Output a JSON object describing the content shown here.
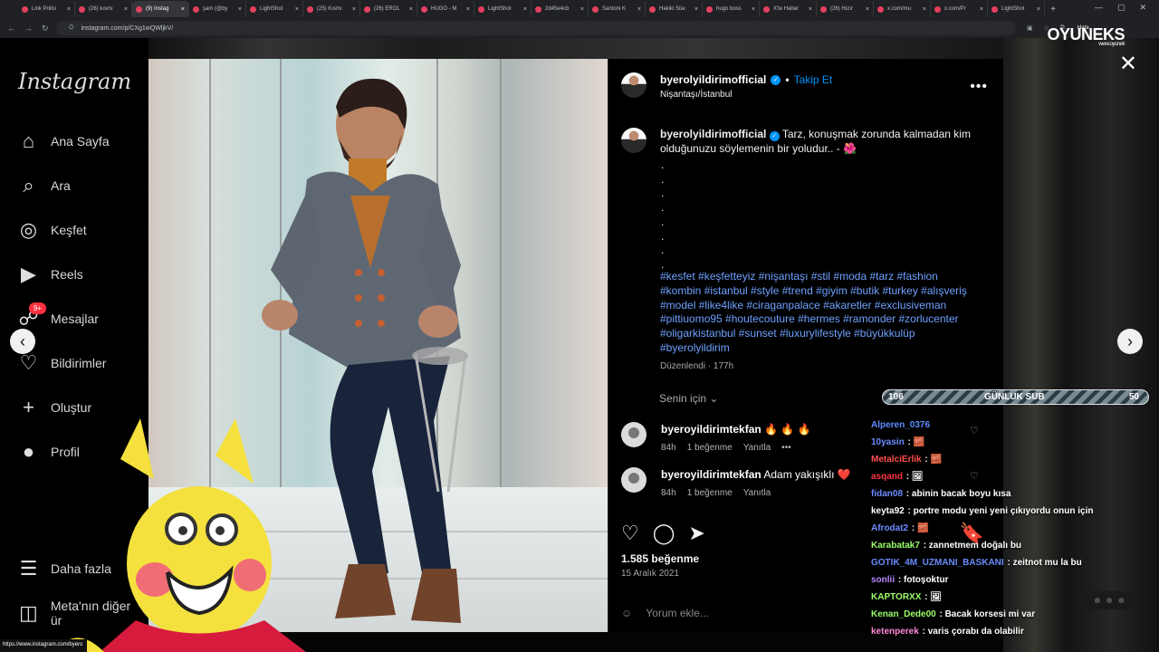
{
  "browser": {
    "tabs": [
      "Link Polisi",
      "(26) kısmı",
      "(9) Instag",
      "şam (@by",
      "LightShot",
      "(25) Kısmı",
      "(26) EROL",
      "HUGO - M",
      "LightShot",
      "2d45e4cb",
      "Santoni K",
      "Hakiki Süe",
      "hugo boss",
      "X'te Haber",
      "(26) Hızır",
      "x.com/mu",
      "x.com/Pr",
      "LightShot"
    ],
    "url": "instagram.com/p/CXg1wQWljkV/",
    "profile_label": "Hata",
    "status_url": "https://www.instagram.com/byero"
  },
  "instagram": {
    "logo": "Instagram",
    "sidebar": [
      {
        "label": "Ana Sayfa",
        "icon": "home-icon"
      },
      {
        "label": "Ara",
        "icon": "search-icon"
      },
      {
        "label": "Keşfet",
        "icon": "compass-icon"
      },
      {
        "label": "Reels",
        "icon": "reels-icon"
      },
      {
        "label": "Mesajlar",
        "icon": "messages-icon",
        "badge": "9+"
      },
      {
        "label": "Bildirimler",
        "icon": "heart-icon"
      },
      {
        "label": "Oluştur",
        "icon": "plus-icon"
      },
      {
        "label": "Profil",
        "icon": "profile-icon"
      },
      {
        "label": "Daha fazla",
        "icon": "menu-icon"
      },
      {
        "label": "Meta'nın diğer ür",
        "icon": "apps-icon"
      }
    ],
    "post": {
      "username": "byerolyildirimofficial",
      "follow": "Takip Et",
      "location": "Nişantaşı/İstanbul",
      "caption": "Tarz, konuşmak zorunda kalmadan kim olduğunuzu söylemenin bir yoludur.. - 🌺",
      "dots": [
        ".",
        ".",
        ".",
        ".",
        ".",
        ".",
        ".",
        "."
      ],
      "hashtags": "#kesfet #keşfetteyiz #nişantaşı #stil #moda #tarz #fashion #kombin #istanbul #style #trend #giyim #butik #turkey #alışveriş #model #like4like #ciraganpalace #akaretler #exclusiveman #pittiuomo95 #houtecouture #hermes #ramonder #zorlucenter #oligarkistanbul #sunset #luxurylifestyle #büyükkulüp #byerolyildirim",
      "edited": "Düzenlendi · 177h",
      "for_you": "Senin için",
      "comments": [
        {
          "user": "byeroyildirimtekfan",
          "text": "🔥 🔥 🔥",
          "time": "84h",
          "likes": "1 beğenme",
          "reply": "Yanıtla"
        },
        {
          "user": "byeroyildirimtekfan",
          "text": "Adam yakışıklı ❤️",
          "time": "84h",
          "likes": "1 beğenme",
          "reply": "Yanıtla"
        }
      ],
      "likes": "1.585 beğenme",
      "date": "15 Aralık 2021",
      "comment_placeholder": "Yorum ekle..."
    }
  },
  "overlay": {
    "brand": "OYUNEKS",
    "brand_url": "www.oyunek",
    "sub_left": "106",
    "sub_label": "GÜNLUK SUB",
    "sub_right": "50",
    "chat": [
      {
        "name": "Alperen_0376",
        "text": "",
        "color": "#5d8cff"
      },
      {
        "name": "10yasin",
        "text": " : 🧱",
        "color": "#6a8cff"
      },
      {
        "name": "MetalciErlik",
        "text": " : 🧱",
        "color": "#ff4d4d"
      },
      {
        "name": "asqand",
        "text": " : 🖼",
        "color": "#ff3344"
      },
      {
        "name": "fidan08",
        "text": " : abinin bacak boyu kısa",
        "color": "#6b8cff"
      },
      {
        "name": "keyta92",
        "text": " : portre modu yeni yeni çıkıyordu onun için",
        "color": "#ffffff"
      },
      {
        "name": "Afrodat2",
        "text": " : 🧱",
        "color": "#6a8cff"
      },
      {
        "name": "Karabatak7",
        "text": " : zannetmem doğalı bu",
        "color": "#9bff68"
      },
      {
        "name": "GOTIK_4M_UZMANI_BASKANI",
        "text": " : zeitnot mu la bu",
        "color": "#6a8cff"
      },
      {
        "name": "sonlii",
        "text": " : fotoşoktur",
        "color": "#b888ff"
      },
      {
        "name": "KAPTORXX",
        "text": " : 🖼",
        "color": "#9bff68"
      },
      {
        "name": "Kenan_Dede00",
        "text": " : Bacak korsesi mi var",
        "color": "#9bff68"
      },
      {
        "name": "ketenperek",
        "text": " : varis çorabı da olabilir",
        "color": "#ff8ad8"
      }
    ]
  },
  "colors": {
    "accent": "#0095f6",
    "hashtag": "#6ea1ff",
    "badge": "#ff3040"
  }
}
